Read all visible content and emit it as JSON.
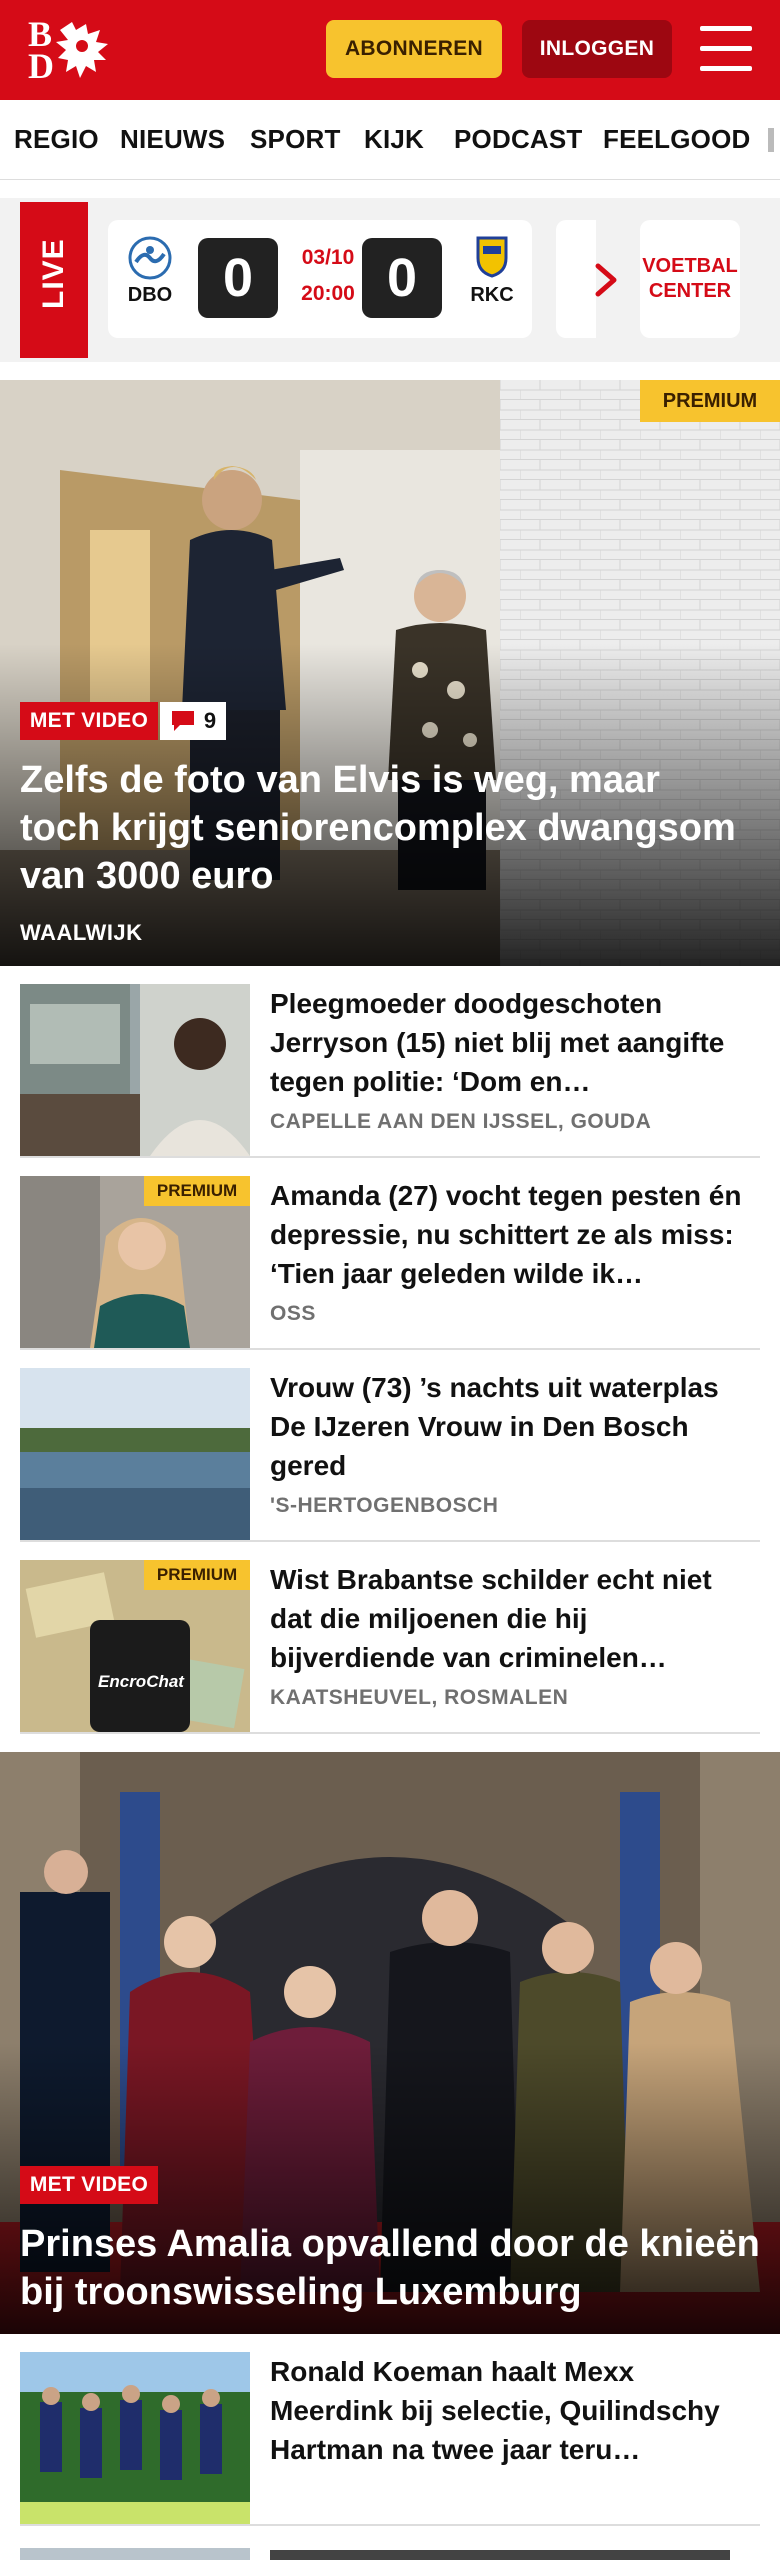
{
  "header": {
    "logo_letters": [
      "B",
      "D"
    ],
    "subscribe_label": "ABONNEREN",
    "login_label": "INLOGGEN",
    "brand_color": "#d50b17",
    "accent_color": "#f7c32e"
  },
  "nav": {
    "items": [
      {
        "label": "REGIO"
      },
      {
        "label": "NIEUWS"
      },
      {
        "label": "SPORT"
      },
      {
        "label": "KIJK"
      },
      {
        "label": "PODCAST"
      },
      {
        "label": "FEELGOOD"
      }
    ]
  },
  "live": {
    "tag": "LIVE",
    "match": {
      "home_team": "DBO",
      "away_team": "RKC",
      "home_score": "0",
      "away_score": "0",
      "date": "03/10",
      "time": "20:00"
    },
    "voetbal_center": [
      "VOETBAL",
      "CENTER"
    ]
  },
  "hero": {
    "premium_label": "PREMIUM",
    "video_label": "MET VIDEO",
    "comment_count": "9",
    "title": "Zelfs de foto van Elvis is weg, maar toch krijgt seniorencomplex dwangsom van 3000 euro",
    "location": "WAALWIJK"
  },
  "articles": [
    {
      "title": "Pleegmoeder doodgeschoten Jerryson (15) niet blij met aangifte tegen politie: ‘Dom en…",
      "location": "CAPELLE AAN DEN IJSSEL, GOUDA",
      "premium": false
    },
    {
      "title": "Amanda (27) vocht tegen pesten én depressie, nu schittert ze als miss: ‘Tien jaar geleden wilde ik…",
      "location": "OSS",
      "premium": true,
      "premium_label": "PREMIUM"
    },
    {
      "title": "Vrouw (73) ’s nachts uit waterplas De IJzeren Vrouw in Den Bosch gered",
      "location": "'S-HERTOGENBOSCH",
      "premium": false
    },
    {
      "title": "Wist Brabantse schilder echt niet dat die miljoenen die hij bijverdiende van criminelen…",
      "location": "KAATSHEUVEL, ROSMALEN",
      "premium": true,
      "premium_label": "PREMIUM",
      "thumb_text": "EncroChat"
    }
  ],
  "hero2": {
    "video_label": "MET VIDEO",
    "title": "Prinses Amalia opvallend door de knieën bij troonswisseling Luxemburg"
  },
  "articles2": [
    {
      "title": "Ronald Koeman haalt Mexx Meerdink bij selectie, Quilind­schy Hartman na twee jaar teru…"
    }
  ]
}
